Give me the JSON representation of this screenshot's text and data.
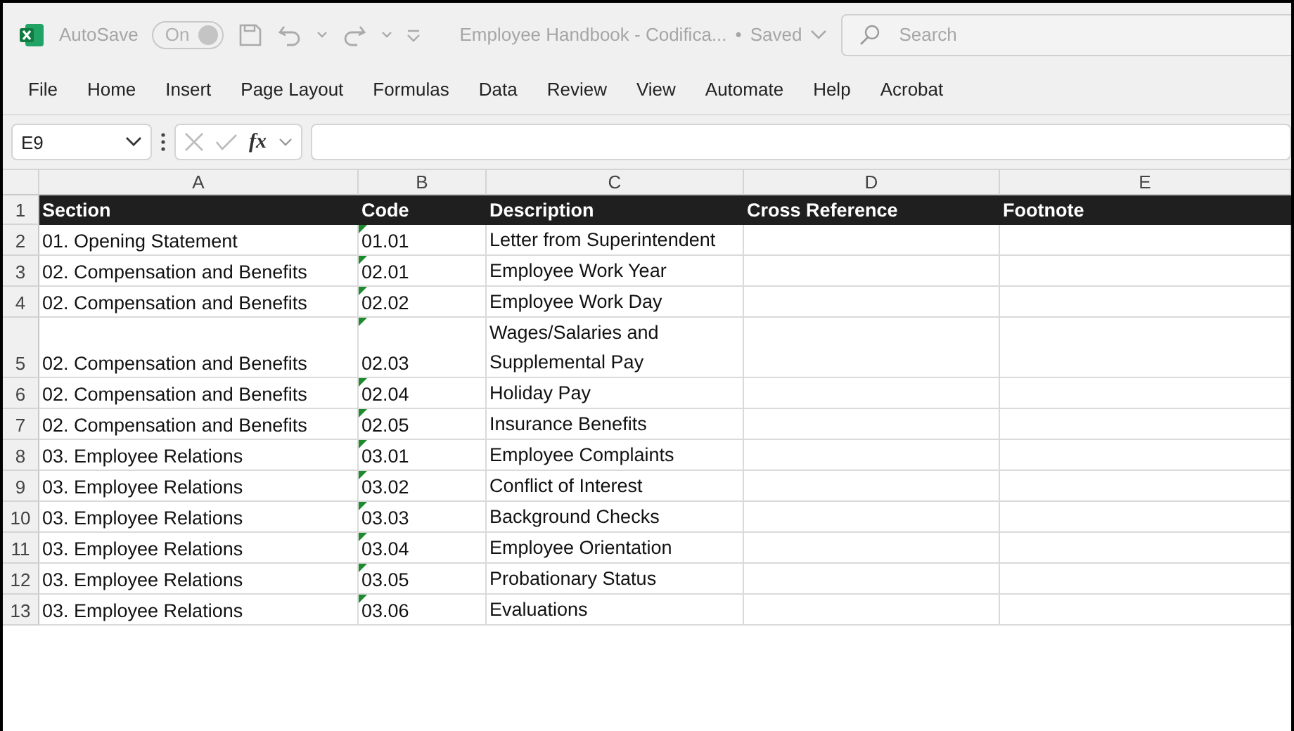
{
  "title_bar": {
    "autosave_label": "AutoSave",
    "autosave_toggle": {
      "label": "On",
      "on": true,
      "disabled": true
    },
    "document_title": "Employee Handbook - Codifica...",
    "separator": "•",
    "save_status": "Saved",
    "search": {
      "placeholder": "Search"
    }
  },
  "menu": [
    {
      "label": "File",
      "selected": false
    },
    {
      "label": "Home",
      "selected": false
    },
    {
      "label": "Insert",
      "selected": false
    },
    {
      "label": "Page Layout",
      "selected": false
    },
    {
      "label": "Formulas",
      "selected": false
    },
    {
      "label": "Data",
      "selected": false
    },
    {
      "label": "Review",
      "selected": false
    },
    {
      "label": "View",
      "selected": false
    },
    {
      "label": "Automate",
      "selected": false
    },
    {
      "label": "Help",
      "selected": false
    },
    {
      "label": "Acrobat",
      "selected": false
    }
  ],
  "formula_bar": {
    "name_box": "E9",
    "function_label": "fx"
  },
  "sheet": {
    "columns": [
      "A",
      "B",
      "C",
      "D",
      "E"
    ],
    "header": {
      "row_number": "1",
      "cells": [
        "Section",
        "Code",
        "Description",
        "Cross Reference",
        "Footnote"
      ]
    },
    "rows": [
      {
        "row_number": "2",
        "cells": [
          "01. Opening Statement",
          "01.01",
          "Letter from Superintendent",
          "",
          ""
        ],
        "error_flag": true
      },
      {
        "row_number": "3",
        "cells": [
          "02. Compensation and Benefits",
          "02.01",
          "Employee Work Year",
          "",
          ""
        ],
        "error_flag": true
      },
      {
        "row_number": "4",
        "cells": [
          "02. Compensation and Benefits",
          "02.02",
          "Employee Work Day",
          "",
          ""
        ],
        "error_flag": true
      },
      {
        "row_number": "5",
        "cells": [
          "02. Compensation and Benefits",
          "02.03",
          "Wages/Salaries and Supplemental Pay",
          "",
          ""
        ],
        "error_flag": true
      },
      {
        "row_number": "6",
        "cells": [
          "02. Compensation and Benefits",
          "02.04",
          "Holiday Pay",
          "",
          ""
        ],
        "error_flag": true
      },
      {
        "row_number": "7",
        "cells": [
          "02. Compensation and Benefits",
          "02.05",
          "Insurance Benefits",
          "",
          ""
        ],
        "error_flag": true
      },
      {
        "row_number": "8",
        "cells": [
          "03. Employee Relations",
          "03.01",
          "Employee Complaints",
          "",
          ""
        ],
        "error_flag": true
      },
      {
        "row_number": "9",
        "cells": [
          "03. Employee Relations",
          "03.02",
          "Conflict of Interest",
          "",
          ""
        ],
        "error_flag": true
      },
      {
        "row_number": "10",
        "cells": [
          "03. Employee Relations",
          "03.03",
          "Background Checks",
          "",
          ""
        ],
        "error_flag": true
      },
      {
        "row_number": "11",
        "cells": [
          "03. Employee Relations",
          "03.04",
          "Employee Orientation",
          "",
          ""
        ],
        "error_flag": true
      },
      {
        "row_number": "12",
        "cells": [
          "03. Employee Relations",
          "03.05",
          "Probationary Status",
          "",
          ""
        ],
        "error_flag": true
      },
      {
        "row_number": "13",
        "cells": [
          "03. Employee Relations",
          "03.06",
          "Evaluations",
          "",
          ""
        ],
        "error_flag": true
      }
    ]
  }
}
